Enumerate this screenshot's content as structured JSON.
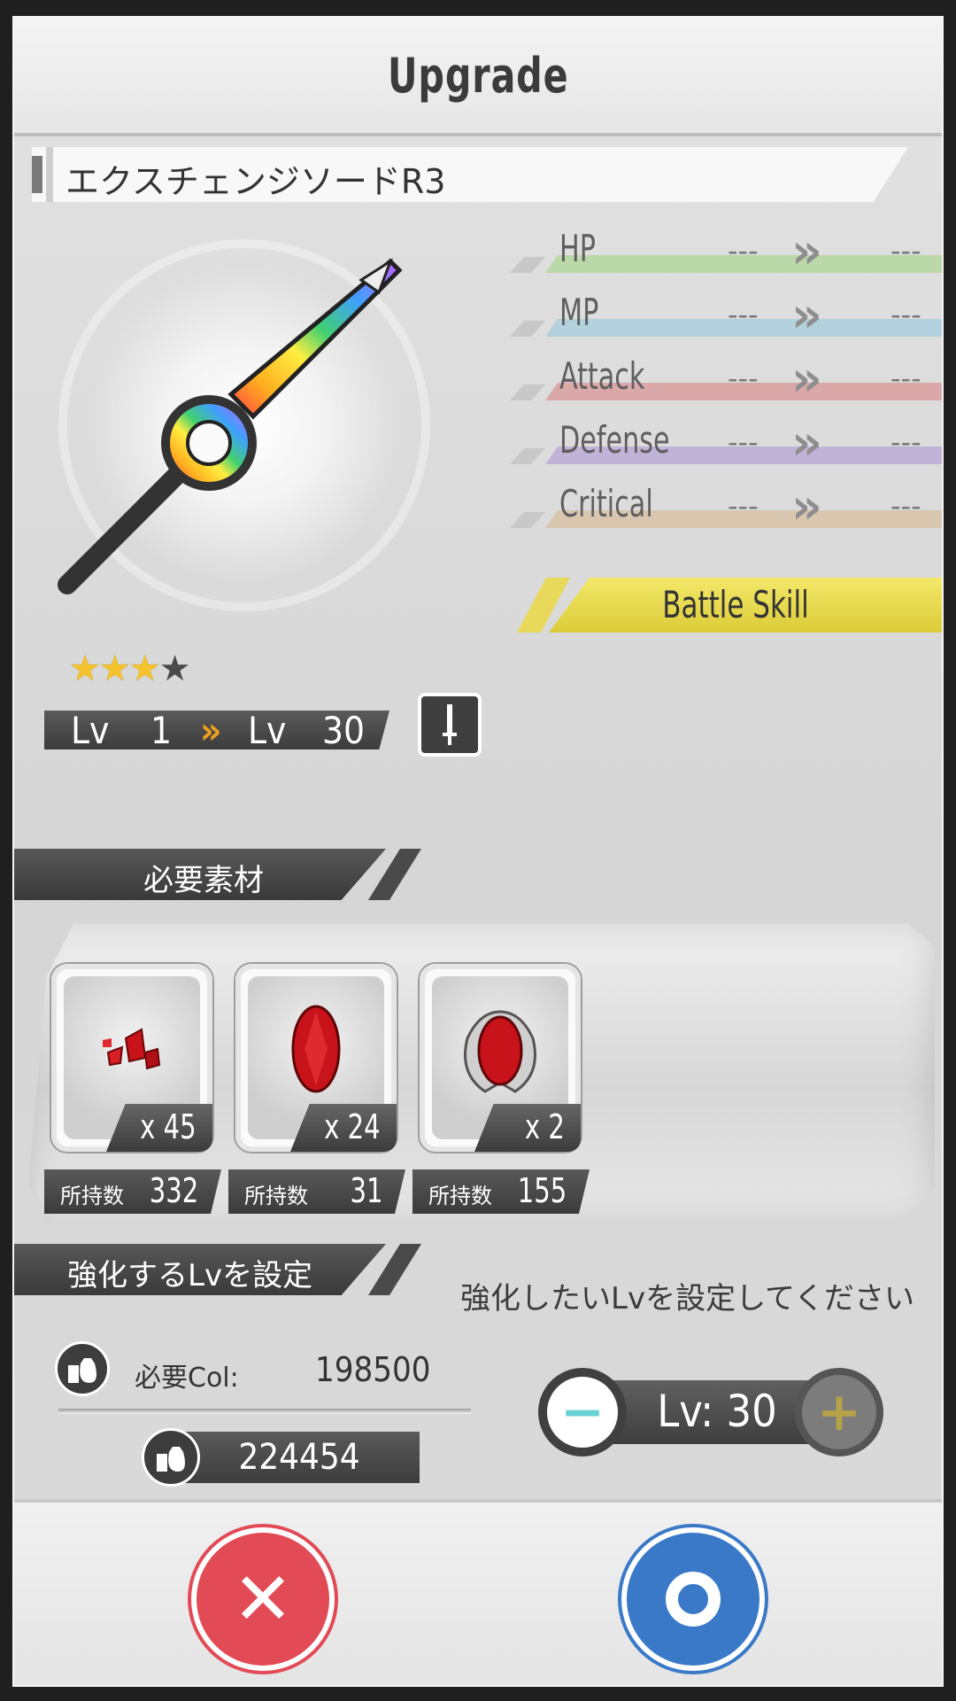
{
  "title": "Upgrade",
  "item": {
    "name": "エクスチェンジソードR3",
    "stars_filled": 3,
    "stars_total": 4,
    "level_label": "Lv",
    "level_from": "1",
    "level_to": "30",
    "level_arrow": "»"
  },
  "stats": [
    {
      "label": "HP",
      "from": "---",
      "to": "---",
      "color": "#9ad27a"
    },
    {
      "label": "MP",
      "from": "---",
      "to": "---",
      "color": "#8ec7dc"
    },
    {
      "label": "Attack",
      "from": "---",
      "to": "---",
      "color": "#d87b7b"
    },
    {
      "label": "Defense",
      "from": "---",
      "to": "---",
      "color": "#ab8fd6"
    },
    {
      "label": "Critical",
      "from": "---",
      "to": "---",
      "color": "#d6b48a"
    }
  ],
  "battle_skill_label": "Battle Skill",
  "materials_header": "必要素材",
  "materials": [
    {
      "icon": "red-shards-icon",
      "qty": "x 45",
      "owned_label": "所持数",
      "owned": "332"
    },
    {
      "icon": "red-gem-icon",
      "qty": "x 24",
      "owned_label": "所持数",
      "owned": "31"
    },
    {
      "icon": "red-crest-gem-icon",
      "qty": "x 2",
      "owned_label": "所持数",
      "owned": "155"
    }
  ],
  "level_set_header": "強化するLvを設定",
  "level_set_hint": "強化したいLvを設定してください",
  "cost": {
    "required_label": "必要Col:",
    "required_value": "198500",
    "owned_value": "224454"
  },
  "stepper": {
    "minus": "−",
    "plus": "+",
    "value_label": "Lv: 30"
  },
  "buttons": {
    "cancel": "✕"
  },
  "colors": {
    "cancel": "#e24a56",
    "ok": "#3a79c8",
    "skill": "#e8da4a"
  }
}
